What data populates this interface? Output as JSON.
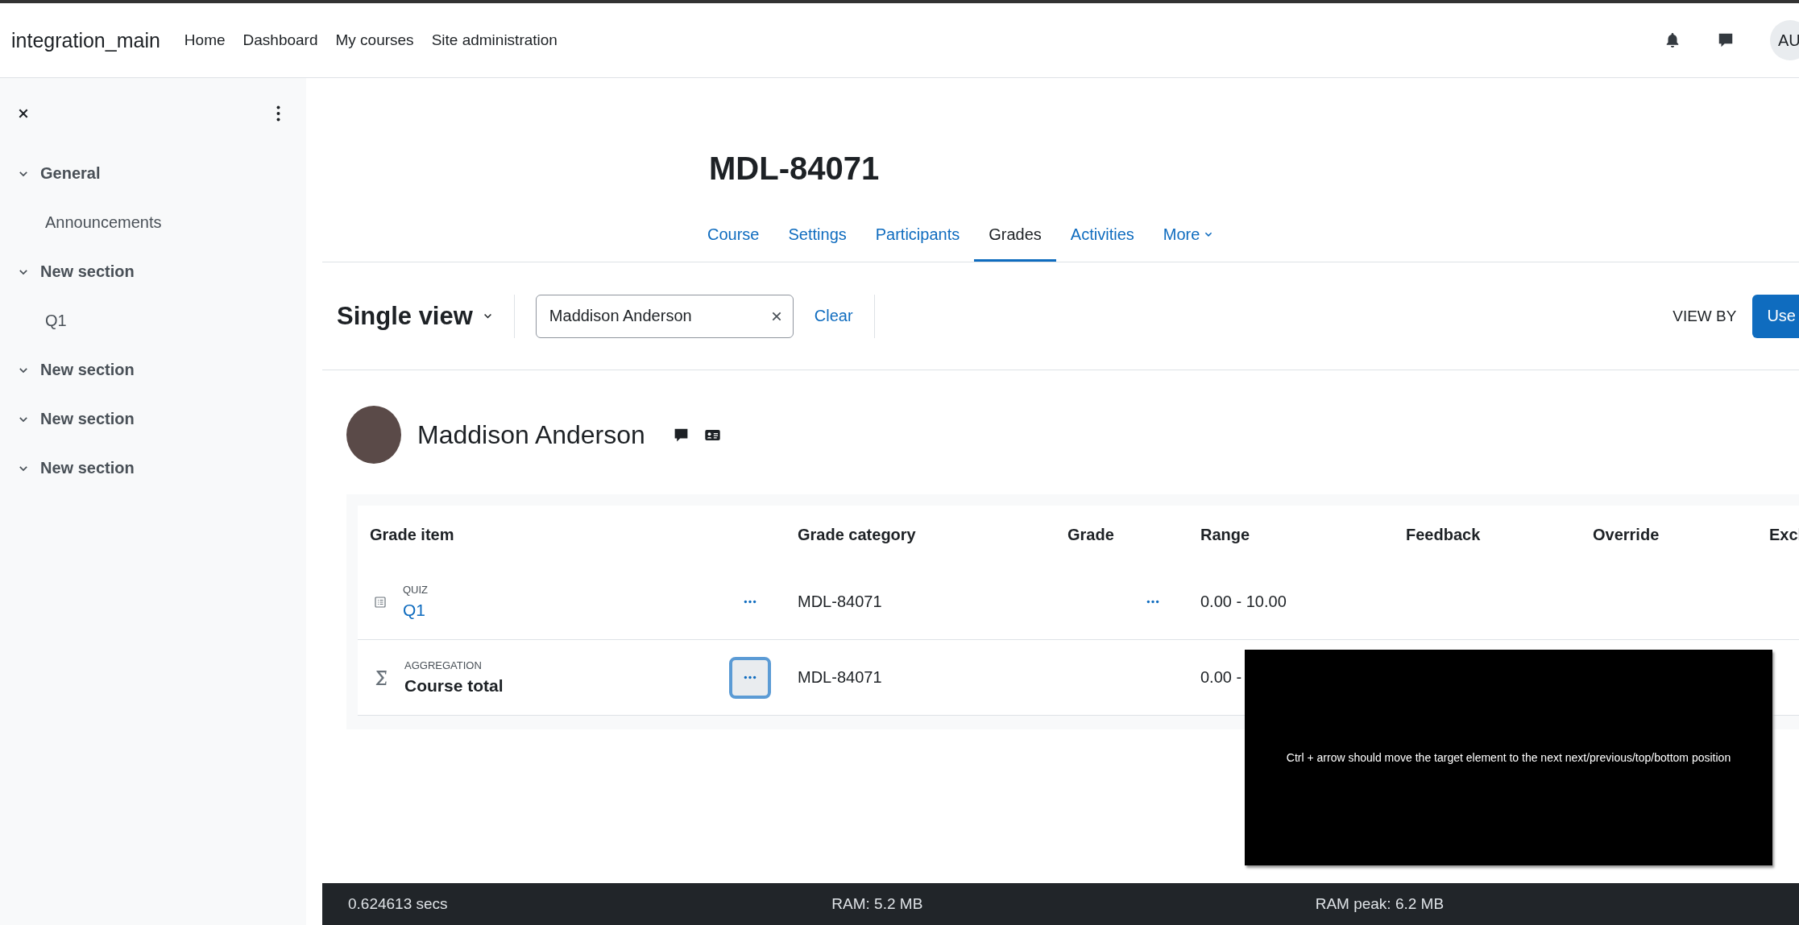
{
  "navbar": {
    "brand": "integration_main",
    "links": [
      "Home",
      "Dashboard",
      "My courses",
      "Site administration"
    ],
    "avatar": "AU"
  },
  "drawer": {
    "sections": [
      {
        "title": "General",
        "expanded": true,
        "children": [
          {
            "title": "Announcements"
          }
        ]
      },
      {
        "title": "New section",
        "expanded": true,
        "children": [
          {
            "title": "Q1"
          }
        ]
      },
      {
        "title": "New section",
        "expanded": true
      },
      {
        "title": "New section",
        "expanded": true
      },
      {
        "title": "New section",
        "expanded": true
      }
    ]
  },
  "page": {
    "title": "MDL-84071",
    "tabs": [
      {
        "label": "Course",
        "selected": false,
        "kind": "link"
      },
      {
        "label": "Settings",
        "selected": false,
        "kind": "link"
      },
      {
        "label": "Participants",
        "selected": false,
        "kind": "link"
      },
      {
        "label": "Grades",
        "selected": true,
        "kind": "link"
      },
      {
        "label": "Activities",
        "selected": false,
        "kind": "link"
      },
      {
        "label": "More",
        "selected": false,
        "kind": "menu"
      }
    ]
  },
  "toolbar": {
    "report": "Single view",
    "search": {
      "value": "Maddison Anderson"
    },
    "clear": "Clear",
    "view_by": "VIEW BY",
    "view_button": "Use"
  },
  "user": {
    "name": "Maddison Anderson"
  },
  "table": {
    "columns": [
      "Grade item",
      "Grade category",
      "Grade",
      "Range",
      "Feedback",
      "Override",
      "Excl"
    ],
    "rows": [
      {
        "kind": "quiz",
        "type": "QUIZ",
        "name": "Q1",
        "category": "MDL-84071",
        "range": "0.00 - 10.00",
        "menu_focused": false
      },
      {
        "kind": "total",
        "type": "AGGREGATION",
        "name": "Course total",
        "category": "MDL-84071",
        "range": "0.00 -",
        "menu_focused": true
      }
    ]
  },
  "overlay": {
    "text": "Ctrl + arrow should move the target element to the next next/previous/top/bottom position"
  },
  "footer": [
    "0.624613 secs",
    "RAM: 5.2 MB",
    "RAM peak: 6.2 MB"
  ]
}
